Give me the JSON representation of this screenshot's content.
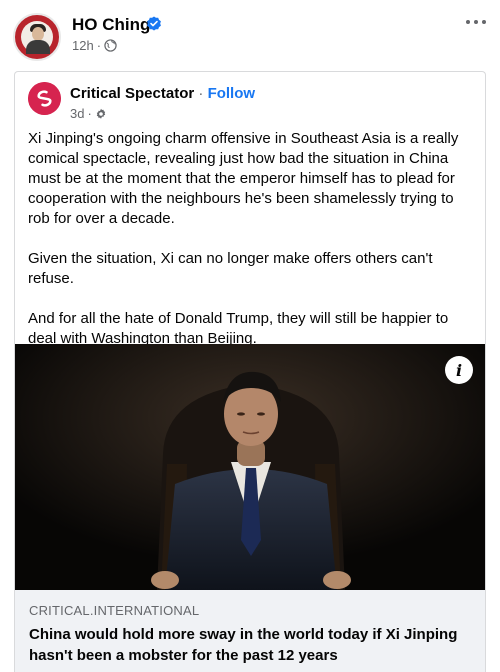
{
  "post": {
    "author": "HO Ching",
    "time": "12h",
    "separator": "·",
    "audience_icon": "globe-icon",
    "menu_icon": "more-options-icon"
  },
  "shared": {
    "page_name": "Critical Spectator",
    "separator": "·",
    "follow_label": "Follow",
    "time": "3d",
    "audience_icon": "settings-gear-icon",
    "paragraphs": [
      "Xi Jinping's ongoing charm offensive in Southeast Asia is a really comical spectacle, revealing just how bad the situation in China must be at the moment that the emperor himself has to plead for cooperation with the neighbours he's been shamelessly trying to rob for over a decade.",
      "Given the situation, Xi can no longer make offers others can't refuse.",
      "And for all the hate of Donald Trump, they will still be happier to deal with Washington than Beijing."
    ]
  },
  "link": {
    "info_label": "i",
    "domain": "CRITICAL.INTERNATIONAL",
    "title": "China would hold more sway in the world today if Xi Jinping hasn't been a mobster for the past 12 years"
  },
  "colors": {
    "accent": "#1877f2",
    "muted_text": "#65676b",
    "page_logo": "#d6244f",
    "footer_bg": "#f0f2f5"
  }
}
